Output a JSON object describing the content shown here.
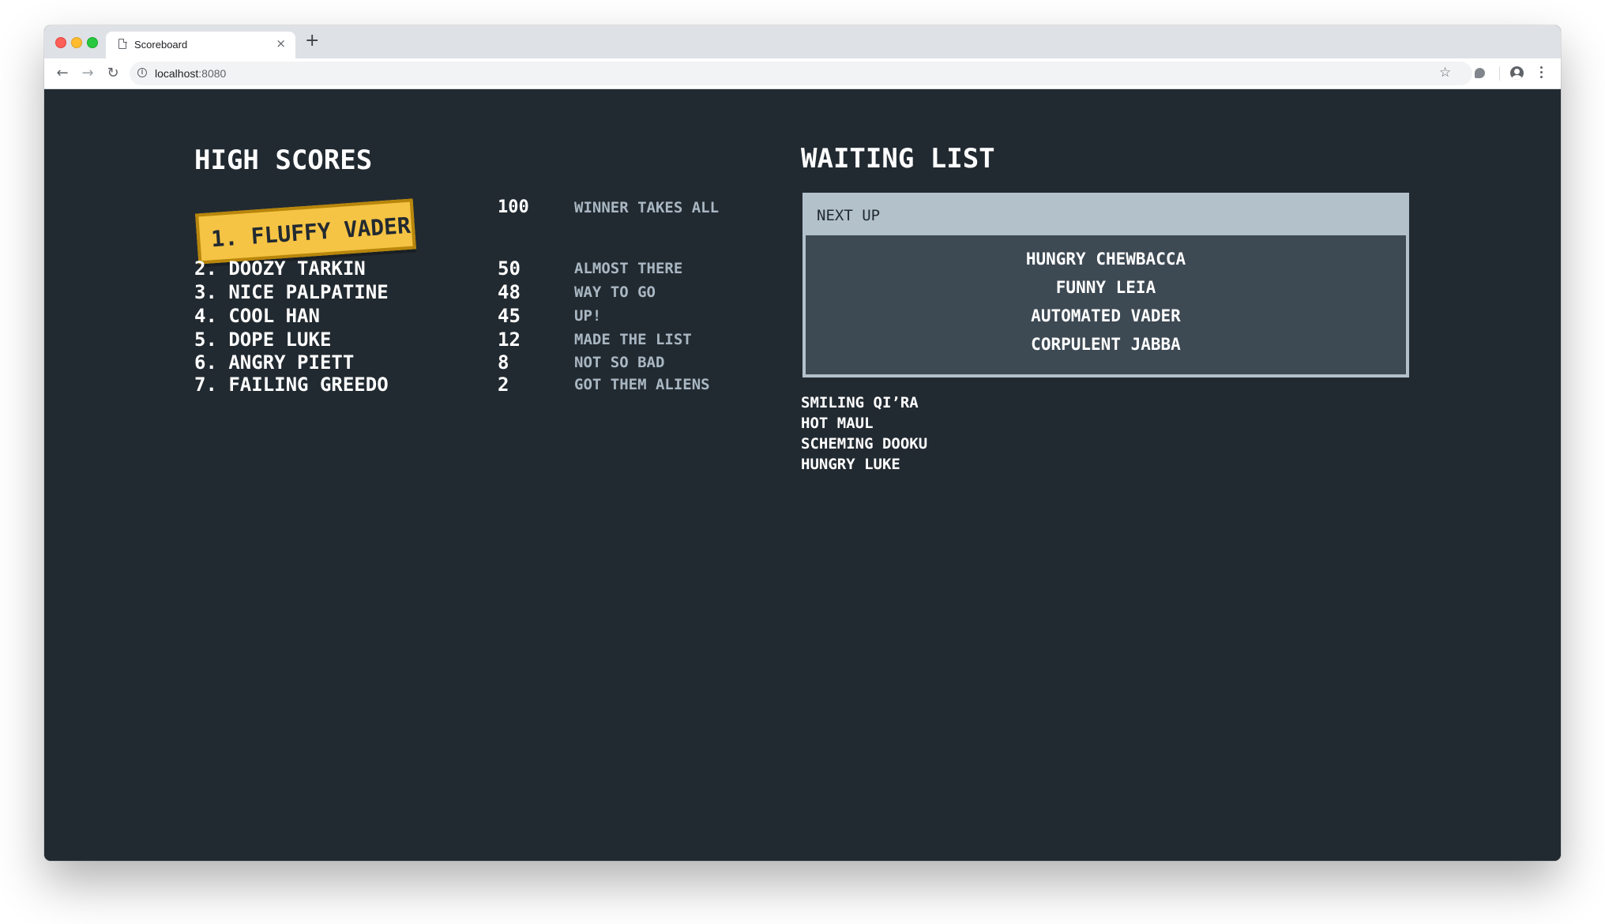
{
  "browser": {
    "tab_title": "Scoreboard",
    "tab_close": "×",
    "new_tab": "+",
    "url_host": "localhost",
    "url_port": ":8080"
  },
  "high_scores": {
    "title": "HIGH SCORES",
    "winner": {
      "name": "1. FLUFFY VADER",
      "points": "100",
      "comment": "WINNER TAKES ALL"
    },
    "rows": [
      {
        "name": "2. DOOZY TARKIN",
        "points": "50",
        "comment": "ALMOST THERE"
      },
      {
        "name": "3. NICE PALPATINE",
        "points": "48",
        "comment": "WAY TO GO"
      },
      {
        "name": "4. COOL HAN",
        "points": "45",
        "comment": "UP!"
      },
      {
        "name": "5. DOPE LUKE",
        "points": "12",
        "comment": "MADE THE LIST"
      },
      {
        "name": "6. ANGRY PIETT",
        "points": "8",
        "comment": "NOT SO BAD"
      },
      {
        "name": "7. FAILING GREEDO",
        "points": "2",
        "comment": "GOT THEM ALIENS"
      }
    ]
  },
  "waiting_list": {
    "title": "WAITING LIST",
    "next_up_label": "NEXT UP",
    "next_up": [
      "HUNGRY CHEWBACCA",
      "FUNNY LEIA",
      "AUTOMATED VADER",
      "CORPULENT JABBA"
    ],
    "queue": [
      "SMILING QI’RA",
      "HOT MAUL",
      "SCHEMING DOOKU",
      "HUNGRY LUKE"
    ]
  },
  "colors": {
    "background": "#222a31",
    "winner_badge": "#f6c444",
    "next_up_box": "#3d4953",
    "next_up_header": "#b3c1cb",
    "comment_text": "#a9b7c3"
  }
}
